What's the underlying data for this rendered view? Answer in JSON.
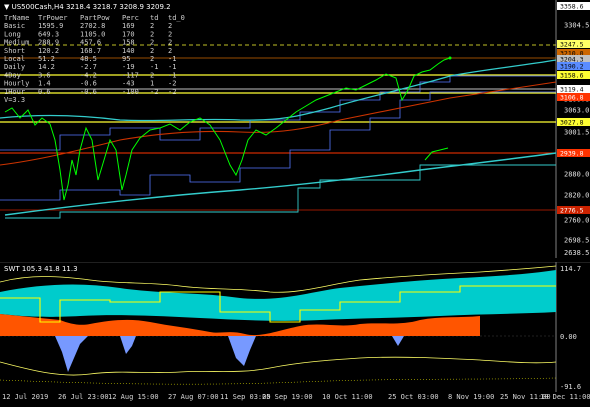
{
  "chart_header": {
    "symbol_line": "▼ US500Cash,H4  3218.4 3218.7 3208.9 3209.2"
  },
  "strength_table": {
    "headers": [
      "TrName",
      "TrPower",
      "PartPow",
      "Perc",
      "td",
      "td_0"
    ],
    "rows": [
      [
        "Basic",
        "1595.9",
        "2702.8",
        "169",
        "2",
        "2"
      ],
      [
        "Long",
        "649.3",
        "1105.0",
        "170",
        "2",
        "2"
      ],
      [
        "Medium",
        "288.9",
        "457.6",
        "158",
        "2",
        "2"
      ],
      [
        "Short",
        "120.2",
        "168.7",
        "140",
        "2",
        "2"
      ],
      [
        "Local",
        "51.2",
        "48.5",
        "95",
        "2",
        "-1"
      ],
      [
        "Daily",
        "14.2",
        "-2.7",
        "-19",
        "-1",
        "-1"
      ],
      [
        "4Day",
        "3.6",
        "-4.2",
        "-117",
        "2",
        "-1"
      ],
      [
        "Hourly",
        "1.4",
        "-0.6",
        "-43",
        "1",
        "-2"
      ],
      [
        "1Hour",
        "0.6",
        "-0.6",
        "-100",
        "-2",
        "-2"
      ]
    ],
    "version": "V=3.3"
  },
  "price_axis": {
    "labels": [
      "3358.6",
      "3304.5",
      "3247.5",
      "3204.3",
      "3190.2",
      "3158.6",
      "3119.4",
      "3106.8",
      "3063.0",
      "3027.8",
      "3001.5",
      "2939.8",
      "2880.0",
      "2820.0",
      "2776.5",
      "2760.0",
      "2698.5",
      "2638.5"
    ]
  },
  "price_tags": [
    {
      "value": "3358.6",
      "color": "#ffffff",
      "text_color": "#000000"
    },
    {
      "value": "3247.5",
      "color": "#ffff66",
      "text_color": "#000000"
    },
    {
      "value": "3210.0",
      "color": "#cc6600",
      "text_color": "#000000"
    },
    {
      "value": "3204.3",
      "color": "#c0c0c0",
      "text_color": "#000000"
    },
    {
      "value": "3190.2",
      "color": "#5a8cff",
      "text_color": "#000000"
    },
    {
      "value": "3158.6",
      "color": "#ffff33",
      "text_color": "#000000"
    },
    {
      "value": "3119.4",
      "color": "#ffffff",
      "text_color": "#000000"
    },
    {
      "value": "3106.8",
      "color": "#ff3300",
      "text_color": "#ffffff"
    },
    {
      "value": "3027.8",
      "color": "#ffff33",
      "text_color": "#000000"
    },
    {
      "value": "2939.8",
      "color": "#ff3300",
      "text_color": "#ffffff"
    },
    {
      "value": "2776.5",
      "color": "#cc2200",
      "text_color": "#ffffff"
    }
  ],
  "oscillator": {
    "label": "SWT 105.3 41.8 11.3",
    "axis_labels": [
      "114.7",
      "0.00",
      "-91.6"
    ]
  },
  "time_axis": {
    "labels": [
      "12 Jul 2019",
      "26 Jul 23:00",
      "12 Aug 15:00",
      "27 Aug 07:00",
      "11 Sep 03:00",
      "25 Sep 19:00",
      "10 Oct 11:00",
      "25 Oct 03:00",
      "8 Nov 19:00",
      "25 Nov 11:00",
      "10 Dec 11:00"
    ]
  },
  "colors": {
    "background": "#000000",
    "price_line": "#00ff00",
    "ma_cyan": "#33cccc",
    "ma_red": "#cc3300",
    "ma_blue": "#5577ff",
    "level_yellow": "#ffff33",
    "osc_cyan": "#00cccc",
    "osc_orange": "#ff5500",
    "osc_blue": "#7799ff"
  }
}
